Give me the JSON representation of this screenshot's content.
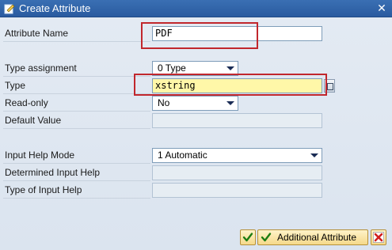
{
  "window": {
    "title": "Create Attribute",
    "icon": "edit-dialog-icon",
    "close_icon": "close-x-icon"
  },
  "fields": {
    "attribute_name": {
      "label": "Attribute Name",
      "value": "PDF"
    },
    "type_assignment": {
      "label": "Type assignment",
      "value": "0 Type"
    },
    "type": {
      "label": "Type",
      "value": "xstring"
    },
    "read_only": {
      "label": "Read-only",
      "value": "No"
    },
    "default_value": {
      "label": "Default Value",
      "value": ""
    },
    "input_help_mode": {
      "label": "Input Help Mode",
      "value": "1 Automatic"
    },
    "determined_input_help": {
      "label": "Determined Input Help",
      "value": ""
    },
    "type_of_input_help": {
      "label": "Type of Input Help",
      "value": ""
    }
  },
  "buttons": {
    "ok_icon": "check-icon",
    "additional_attribute_label": "Additional Attribute",
    "additional_attribute_icon": "check-icon",
    "cancel_icon": "cancel-icon"
  },
  "colors": {
    "highlight_frame": "#c1272d",
    "input_highlight": "#fff7a8",
    "title_bar": "#2f63a8"
  }
}
